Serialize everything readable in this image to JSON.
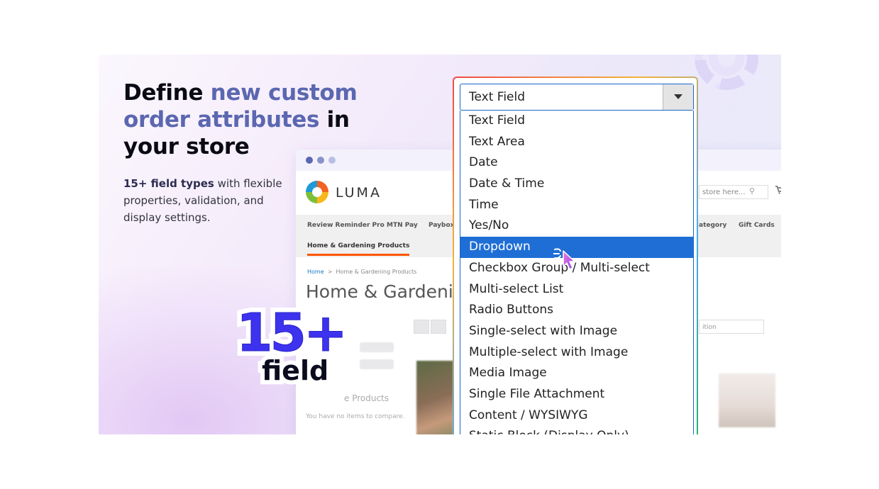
{
  "hero": {
    "headline_part1": "Define ",
    "headline_accent": "new custom order attributes",
    "headline_part2": " in your store",
    "sub_bold": "15+ field types",
    "sub_rest": " with flexible properties, validation, and display settings."
  },
  "badge": {
    "number": "15+",
    "word": "field"
  },
  "store": {
    "logo_text": "LUMA",
    "search_placeholder": "store here...",
    "nav": [
      "Review Reminder Pro",
      "MTN Pay",
      "Paybox",
      "ategory",
      "Gift Cards",
      "Home & Gardening Products"
    ],
    "breadcrumb_home": "Home",
    "breadcrumb_sep": ">",
    "breadcrumb_current": "Home & Gardening Products",
    "page_title": "Home & Gardening",
    "compare_title": "e Products",
    "compare_note": "You have no items to compare.",
    "sorter_text": "ition"
  },
  "select": {
    "value": "Text Field",
    "selected_index": 6,
    "options": [
      "Text Field",
      "Text Area",
      "Date",
      "Date & Time",
      "Time",
      "Yes/No",
      "Dropdown",
      "Checkbox Group / Multi-select",
      "Multi-select List",
      "Radio Buttons",
      "Single-select with Image",
      "Multiple-select with Image",
      "Media Image",
      "Single File Attachment",
      "Content / WYSIWYG",
      "Static Block (Display Only)"
    ]
  },
  "colors": {
    "accent": "#5b67b0",
    "selected": "#1f6ed6",
    "badge": "#3d33ee"
  },
  "icons": {
    "cursor": "pointer-hand-icon",
    "cart": "cart-icon",
    "search": "search-icon"
  }
}
